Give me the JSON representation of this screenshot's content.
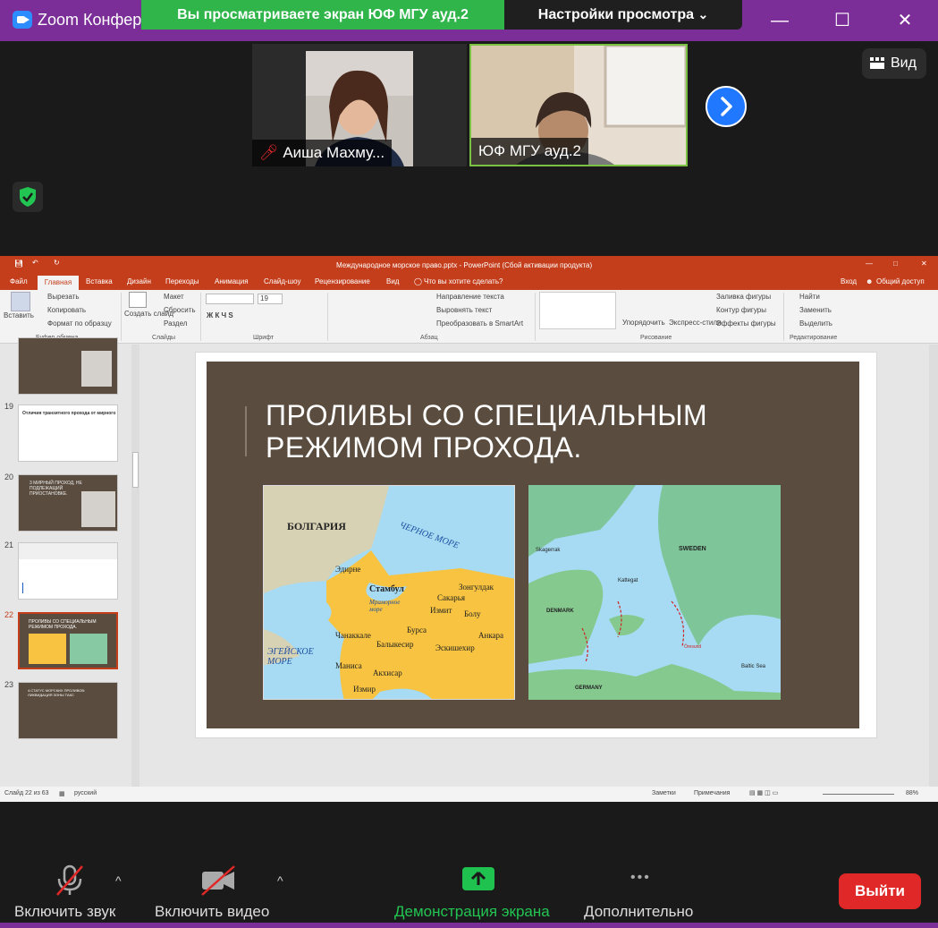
{
  "titlebar": {
    "app_title": "Zoom Конференция",
    "share_banner": "Вы просматриваете экран ЮФ МГУ ауд.2",
    "view_options": "Настройки просмотра",
    "view_options_chevron": "⌄",
    "minimize": "—",
    "maximize": "☐",
    "close": "✕"
  },
  "participants": [
    {
      "name": "Аиша Махму...",
      "muted": true
    },
    {
      "name": "ЮФ МГУ ауд.2",
      "muted": false,
      "active_speaker": true
    }
  ],
  "view_button": "Вид",
  "next_icon": "chevron-right-icon",
  "powerpoint": {
    "window_title": "Международное морское право.pptx - PowerPoint (Сбой активации продукта)",
    "tabs": [
      "Файл",
      "Главная",
      "Вставка",
      "Дизайн",
      "Переходы",
      "Анимация",
      "Слайд-шоу",
      "Рецензирование",
      "Вид"
    ],
    "tell_me": "Что вы хотите сделать?",
    "sign_in": "Вход",
    "share": "Общий доступ",
    "ribbon": {
      "paste": "Вставить",
      "cut": "Вырезать",
      "copy": "Копировать",
      "format_painter": "Формат по образцу",
      "clipboard_group": "Буфер обмена",
      "new_slide": "Создать слайд",
      "layout": "Макет",
      "reset": "Сбросить",
      "section": "Раздел",
      "slides_group": "Слайды",
      "font_size": "19",
      "font_group": "Шрифт",
      "text_direction": "Направление текста",
      "align_text": "Выровнять текст",
      "smartart": "Преобразовать в SmartArt",
      "paragraph_group": "Абзац",
      "arrange": "Упорядочить",
      "quick_styles": "Экспресс-стили",
      "shape_fill": "Заливка фигуры",
      "shape_outline": "Контур фигуры",
      "shape_effects": "Эффекты фигуры",
      "drawing_group": "Рисование",
      "find": "Найти",
      "replace": "Заменить",
      "select": "Выделить",
      "editing_group": "Редактирование"
    },
    "slide_thumbs": [
      {
        "num": "",
        "title": "ПРИМЕНЯЕТСЯ"
      },
      {
        "num": "19",
        "title": "Отличия транзитного прохода от мирного"
      },
      {
        "num": "20",
        "title": "3 МИРНЫЙ ПРОХОД, НЕ ПОДЛЕЖАЩИЙ ПРИОСТАНОВКЕ."
      },
      {
        "num": "21",
        "title": ""
      },
      {
        "num": "22",
        "title": "ПРОЛИВЫ СО СПЕЦИАЛЬНЫМ РЕЖИМОМ ПРОХОДА."
      },
      {
        "num": "23",
        "title": "4.СТАТУС МОРСКИХ ПРОЛИВОВ: ЛИКВИДАЦИЯ ЗОНЫ ТАКС"
      }
    ],
    "slide_title_line1": "ПРОЛИВЫ СО СПЕЦИАЛЬНЫМ",
    "slide_title_line2": "РЕЖИМОМ ПРОХОДА.",
    "map1": {
      "labels": [
        "БОЛГАРИЯ",
        "ЧЕРНОЕ МОРЕ",
        "Эдирне",
        "Стамбул",
        "Зонгулдак",
        "Сакарья",
        "Мраморное море",
        "Измит",
        "Болу",
        "Бурса",
        "Анкара",
        "Чанаккале",
        "Балыкесир",
        "Эскишехир",
        "ЭГЕЙСКОЕ МОРЕ",
        "Маниса",
        "Акхисар",
        "Измир"
      ]
    },
    "map2": {
      "labels": [
        "Skagerrak",
        "SWEDEN",
        "Kattegat",
        "DENMARK",
        "Öresund",
        "Baltic Sea",
        "GERMANY"
      ]
    },
    "status": {
      "slide": "Слайд 22 из 63",
      "language": "русский",
      "notes": "Заметки",
      "comments": "Примечания",
      "zoom": "88%"
    }
  },
  "toolbar": {
    "audio": "Включить звук",
    "video": "Включить видео",
    "share": "Демонстрация экрана",
    "more": "Дополнительно",
    "more_dots": "•••",
    "leave": "Выйти",
    "caret": "^"
  },
  "colors": {
    "zoom_purple": "#7b2d98",
    "banner_green": "#2fb54a",
    "ppt_orange": "#c43e1c",
    "leave_red": "#e02828",
    "share_green": "#1fc24f"
  }
}
